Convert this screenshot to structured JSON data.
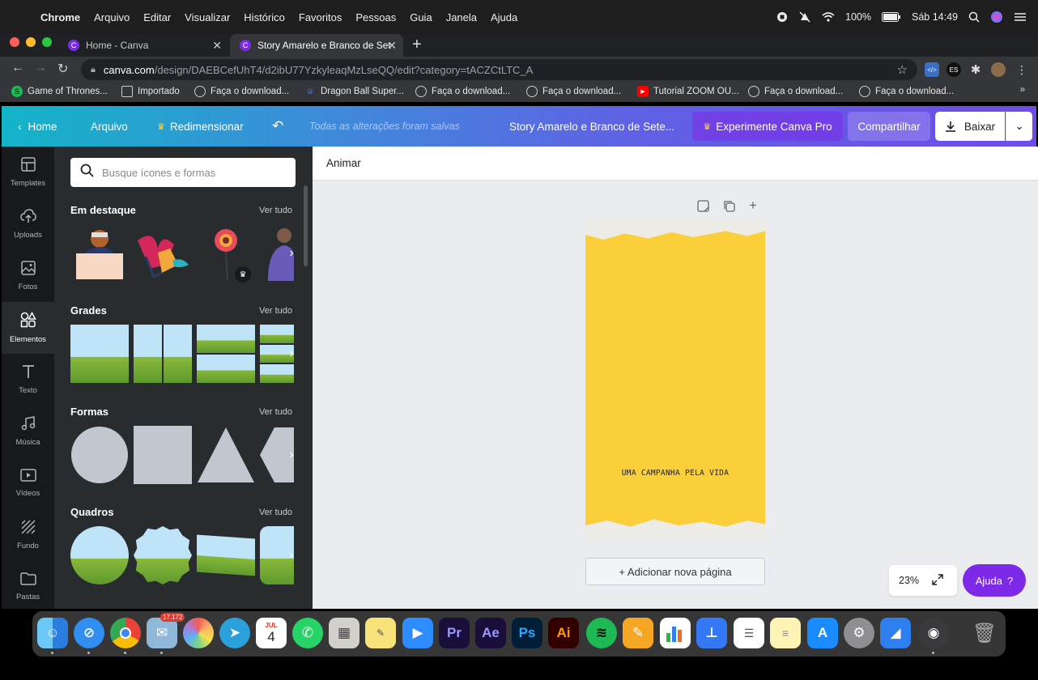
{
  "menubar": {
    "app": "Chrome",
    "items": [
      "Arquivo",
      "Editar",
      "Visualizar",
      "Histórico",
      "Favoritos",
      "Pessoas",
      "Guia",
      "Janela",
      "Ajuda"
    ],
    "battery": "100%",
    "clock": "Sáb 14:49"
  },
  "browser": {
    "tabs": [
      {
        "title": "Home - Canva",
        "active": false
      },
      {
        "title": "Story Amarelo e Branco de Set",
        "active": true
      }
    ],
    "url_host": "canva.com",
    "url_path": "/design/DAEBCefUhT4/d2ibU77YzkyleaqMzLseQQ/edit?category=tACZCtLTC_A",
    "bookmarks": [
      "Game of Thrones...",
      "Importado",
      "Faça o download...",
      "Dragon Ball Super...",
      "Faça o download...",
      "Faça o download...",
      "Tutorial ZOOM OU...",
      "Faça o download...",
      "Faça o download..."
    ]
  },
  "canva_header": {
    "home": "Home",
    "file": "Arquivo",
    "resize": "Redimensionar",
    "saved_status": "Todas as alterações foram salvas",
    "design_title": "Story Amarelo e Branco de Sete...",
    "try_pro": "Experimente Canva Pro",
    "share": "Compartilhar",
    "download": "Baixar"
  },
  "sidebar": {
    "items": [
      {
        "label": "Templates",
        "icon": "templates-icon"
      },
      {
        "label": "Uploads",
        "icon": "upload-icon"
      },
      {
        "label": "Fotos",
        "icon": "photo-icon"
      },
      {
        "label": "Elementos",
        "icon": "elements-icon",
        "active": true
      },
      {
        "label": "Texto",
        "icon": "text-icon"
      },
      {
        "label": "Música",
        "icon": "music-icon"
      },
      {
        "label": "Vídeos",
        "icon": "video-icon"
      },
      {
        "label": "Fundo",
        "icon": "background-icon"
      },
      {
        "label": "Pastas",
        "icon": "folder-icon"
      }
    ]
  },
  "panel": {
    "search_placeholder": "Busque ícones e formas",
    "sections": [
      {
        "title": "Em destaque",
        "link": "Ver tudo"
      },
      {
        "title": "Grades",
        "link": "Ver tudo"
      },
      {
        "title": "Formas",
        "link": "Ver tudo"
      },
      {
        "title": "Quadros",
        "link": "Ver tudo"
      }
    ]
  },
  "editor": {
    "animate": "Animar",
    "design_text": "UMA CAMPANHA PELA VIDA",
    "add_page": "+ Adicionar nova página",
    "zoom": "23%",
    "help": "Ajuda"
  },
  "dock": {
    "calendar_month": "JUL",
    "calendar_day": "4",
    "mail_badge": "17.172"
  },
  "colors": {
    "canva_purple": "#7d2ae8",
    "design_yellow": "#fbcf3a",
    "panel_bg": "#292c2f"
  }
}
